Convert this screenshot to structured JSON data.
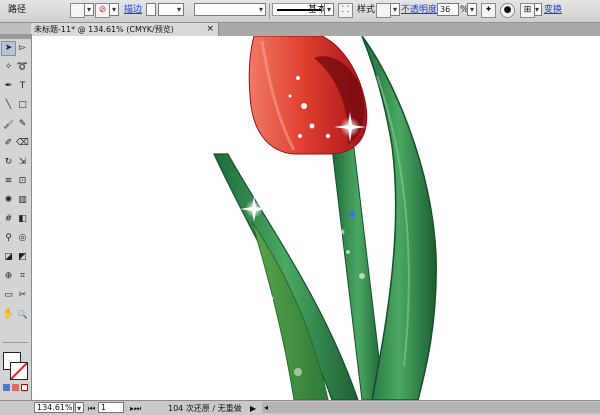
{
  "control_bar": {
    "path_label": "路径",
    "stroke_label": "描边",
    "line_style": "基本",
    "style_label": "样式:",
    "opacity_label": "不透明度:",
    "opacity_value": "36",
    "opacity_unit": "%",
    "transform_label": "变换"
  },
  "document_tab": {
    "title": "未标题-11* @ 134.61% (CMYK/预览)",
    "close_glyph": "×"
  },
  "tools": {
    "icons": [
      "selection-icon",
      "direct-selection-icon",
      "magic-wand-icon",
      "lasso-icon",
      "pen-icon",
      "type-icon",
      "line-icon",
      "rectangle-icon",
      "paintbrush-icon",
      "pencil-icon",
      "blob-brush-icon",
      "eraser-icon",
      "rotate-icon",
      "scale-icon",
      "warp-icon",
      "free-transform-icon",
      "symbol-sprayer-icon",
      "graph-icon",
      "mesh-icon",
      "gradient-icon",
      "eyedropper-icon",
      "blend-icon",
      "live-paint-icon",
      "live-paint-select-icon",
      "perspective-icon",
      "perspective-grid-icon",
      "artboard-icon",
      "slice-icon",
      "hand-icon",
      "zoom-icon"
    ]
  },
  "colors": {
    "tulip_red": "#e23a2e",
    "leaf_green": "#2f8a4a",
    "accent_blue": "#1f3fd0"
  },
  "status_bar": {
    "zoom": "134.61%",
    "page": "1",
    "info": "104 次还原 / 无重做"
  }
}
